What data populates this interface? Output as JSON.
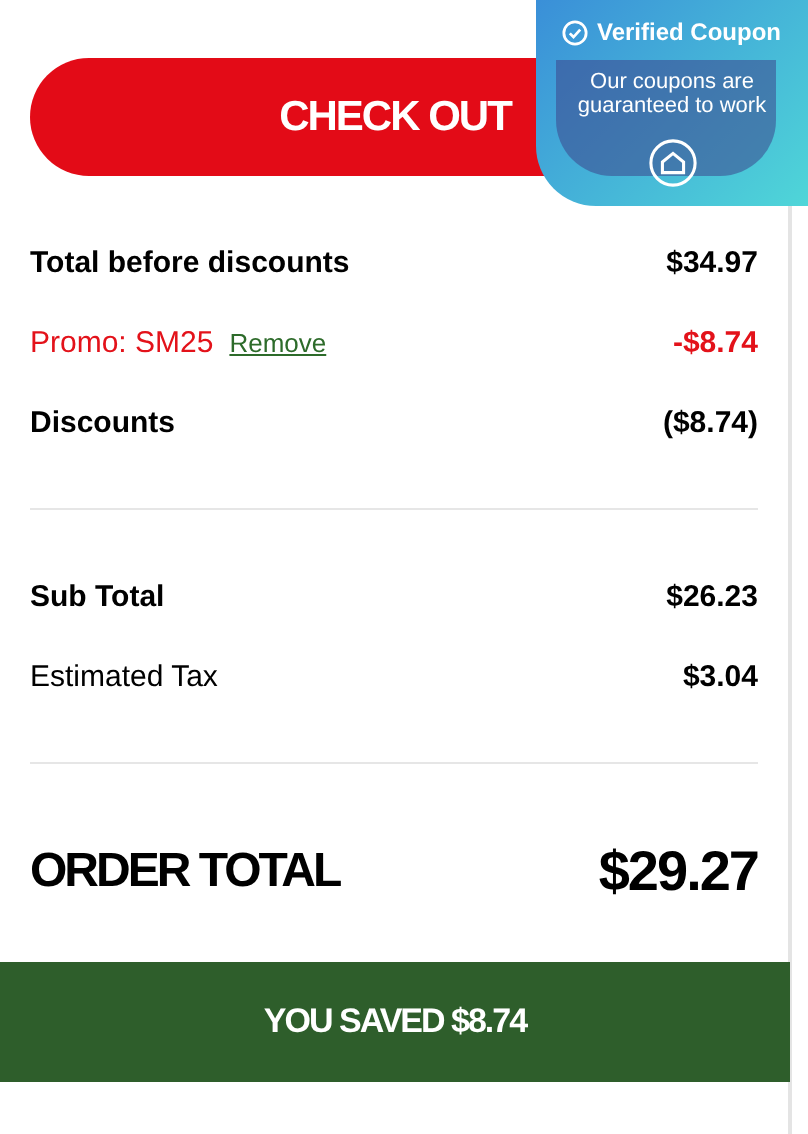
{
  "checkout_button": {
    "label": "CHECK OUT"
  },
  "coupon_badge": {
    "title": "Verified Coupon",
    "message": "Our coupons are guaranteed to work"
  },
  "summary_sections": [
    {
      "rows": [
        {
          "kind": "bold",
          "label": "Total before discounts",
          "value": "$34.97"
        },
        {
          "kind": "promo",
          "label": "Promo: SM25",
          "action": "Remove",
          "value": "-$8.74"
        },
        {
          "kind": "bold",
          "label": "Discounts",
          "value": "($8.74)"
        }
      ]
    },
    {
      "rows": [
        {
          "kind": "bold",
          "label": "Sub Total",
          "value": "$26.23"
        },
        {
          "kind": "plain",
          "label": "Estimated Tax",
          "value": "$3.04"
        }
      ]
    }
  ],
  "order_total": {
    "label": "ORDER TOTAL",
    "value": "$29.27"
  },
  "savings_banner": {
    "text": "YOU SAVED $8.74"
  }
}
